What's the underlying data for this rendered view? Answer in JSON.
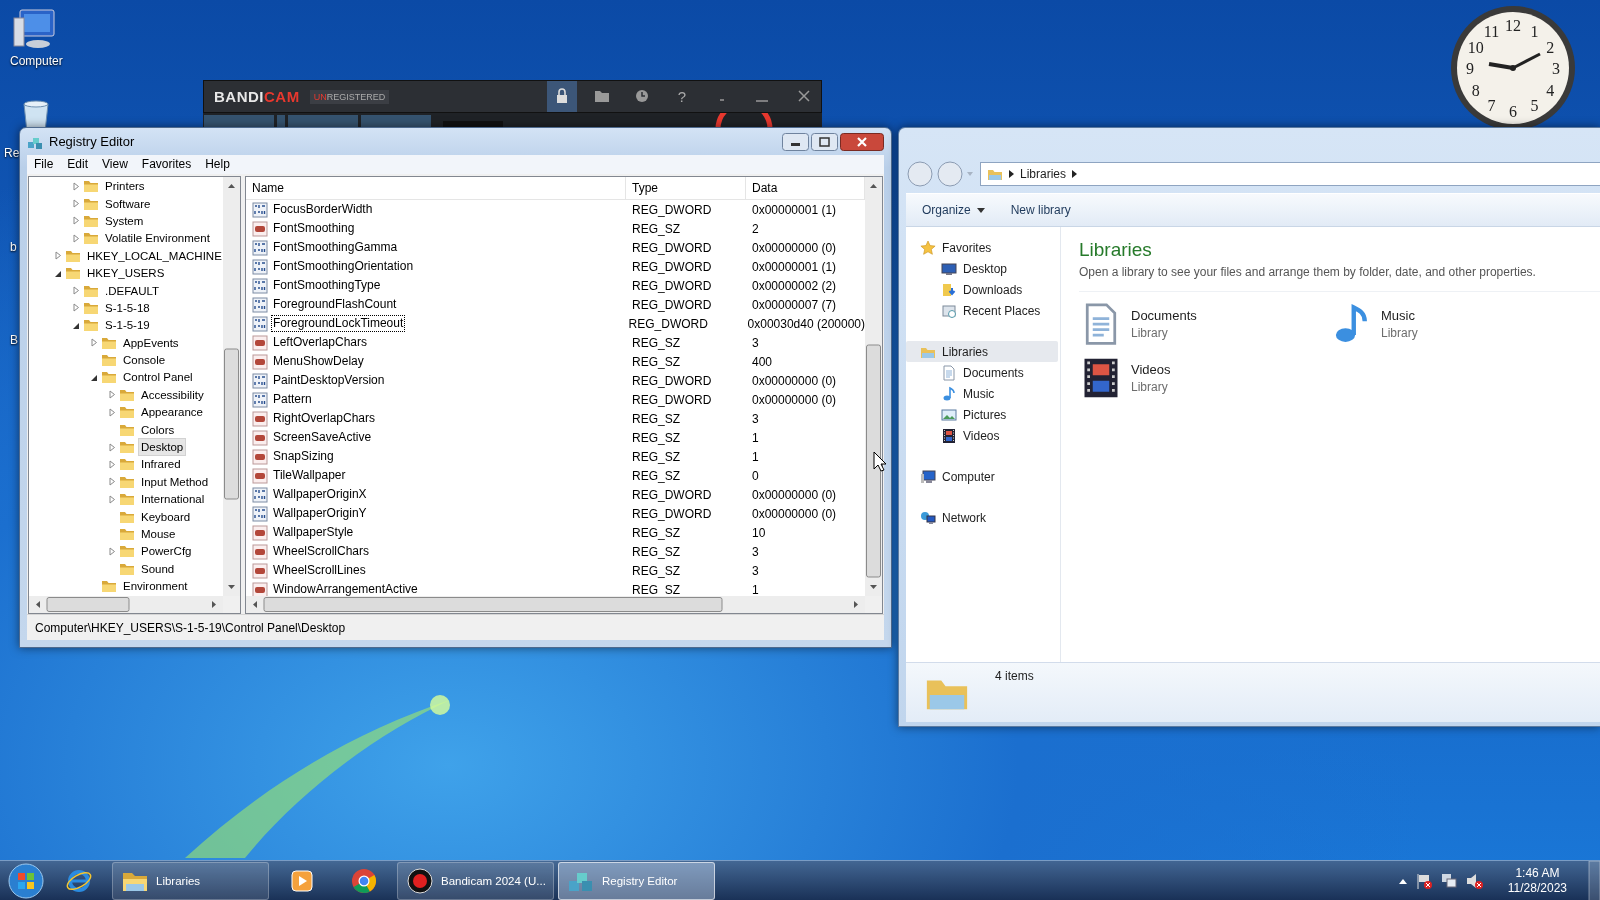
{
  "desktop_icons": [
    {
      "label": "Computer",
      "kind": "computer"
    },
    {
      "label": "Re",
      "kind": "recycle"
    },
    {
      "label": "b",
      "kind": "hidden"
    },
    {
      "label": "B",
      "kind": "hidden"
    }
  ],
  "bandicam": {
    "logo": [
      "BANDI",
      "CAM"
    ],
    "badge": [
      "UN",
      "REGISTERED"
    ],
    "help": "?"
  },
  "clock": {
    "numerals": [
      "11",
      "12",
      "1",
      "10",
      "2",
      "9",
      "3",
      "8",
      "4",
      "7",
      "5",
      "6"
    ]
  },
  "registry_editor": {
    "title": "Registry Editor",
    "menu": [
      "File",
      "Edit",
      "View",
      "Favorites",
      "Help"
    ],
    "tree": {
      "upper_items": [
        {
          "label": "Printers",
          "expanded": false,
          "selected": false
        },
        {
          "label": "Software",
          "expanded": false,
          "selected": false
        },
        {
          "label": "System",
          "expanded": false,
          "selected": false
        },
        {
          "label": "Volatile Environment",
          "expanded": false,
          "selected": false
        }
      ],
      "items": [
        {
          "label": "HKEY_LOCAL_MACHINE",
          "expanded": false,
          "selected": false
        },
        {
          "label": "HKEY_USERS",
          "expanded": true,
          "selected": false,
          "children": [
            {
              "label": ".DEFAULT",
              "expanded": false,
              "selected": false
            },
            {
              "label": "S-1-5-18",
              "expanded": false,
              "selected": false
            },
            {
              "label": "S-1-5-19",
              "expanded": true,
              "selected": false,
              "children": [
                {
                  "label": "AppEvents",
                  "expanded": false,
                  "selected": false
                },
                {
                  "label": "Console",
                  "selected": false
                },
                {
                  "label": "Control Panel",
                  "expanded": true,
                  "selected": false,
                  "children": [
                    {
                      "label": "Accessibility",
                      "expanded": false,
                      "selected": false
                    },
                    {
                      "label": "Appearance",
                      "expanded": false,
                      "selected": false
                    },
                    {
                      "label": "Colors",
                      "selected": false
                    },
                    {
                      "label": "Desktop",
                      "expanded": false,
                      "selected": true
                    },
                    {
                      "label": "Infrared",
                      "expanded": false,
                      "selected": false
                    },
                    {
                      "label": "Input Method",
                      "expanded": false,
                      "selected": false
                    },
                    {
                      "label": "International",
                      "expanded": false,
                      "selected": false
                    },
                    {
                      "label": "Keyboard",
                      "selected": false
                    },
                    {
                      "label": "Mouse",
                      "selected": false
                    },
                    {
                      "label": "PowerCfg",
                      "expanded": false,
                      "selected": false
                    },
                    {
                      "label": "Sound",
                      "selected": false
                    }
                  ]
                },
                {
                  "label": "Environment",
                  "selected": false
                }
              ]
            }
          ]
        }
      ]
    },
    "columns": [
      "Name",
      "Type",
      "Data"
    ],
    "rows": [
      {
        "name": "FocusBorderWidth",
        "type": "REG_DWORD",
        "data": "0x00000001 (1)",
        "kind": "dword",
        "focused": false
      },
      {
        "name": "FontSmoothing",
        "type": "REG_SZ",
        "data": "2",
        "kind": "sz",
        "focused": false
      },
      {
        "name": "FontSmoothingGamma",
        "type": "REG_DWORD",
        "data": "0x00000000 (0)",
        "kind": "dword",
        "focused": false
      },
      {
        "name": "FontSmoothingOrientation",
        "type": "REG_DWORD",
        "data": "0x00000001 (1)",
        "kind": "dword",
        "focused": false
      },
      {
        "name": "FontSmoothingType",
        "type": "REG_DWORD",
        "data": "0x00000002 (2)",
        "kind": "dword",
        "focused": false
      },
      {
        "name": "ForegroundFlashCount",
        "type": "REG_DWORD",
        "data": "0x00000007 (7)",
        "kind": "dword",
        "focused": false
      },
      {
        "name": "ForegroundLockTimeout",
        "type": "REG_DWORD",
        "data": "0x00030d40 (200000)",
        "kind": "dword",
        "focused": true
      },
      {
        "name": "LeftOverlapChars",
        "type": "REG_SZ",
        "data": "3",
        "kind": "sz",
        "focused": false
      },
      {
        "name": "MenuShowDelay",
        "type": "REG_SZ",
        "data": "400",
        "kind": "sz",
        "focused": false
      },
      {
        "name": "PaintDesktopVersion",
        "type": "REG_DWORD",
        "data": "0x00000000 (0)",
        "kind": "dword",
        "focused": false
      },
      {
        "name": "Pattern",
        "type": "REG_DWORD",
        "data": "0x00000000 (0)",
        "kind": "dword",
        "focused": false
      },
      {
        "name": "RightOverlapChars",
        "type": "REG_SZ",
        "data": "3",
        "kind": "sz",
        "focused": false
      },
      {
        "name": "ScreenSaveActive",
        "type": "REG_SZ",
        "data": "1",
        "kind": "sz",
        "focused": false
      },
      {
        "name": "SnapSizing",
        "type": "REG_SZ",
        "data": "1",
        "kind": "sz",
        "focused": false
      },
      {
        "name": "TileWallpaper",
        "type": "REG_SZ",
        "data": "0",
        "kind": "sz",
        "focused": false
      },
      {
        "name": "WallpaperOriginX",
        "type": "REG_DWORD",
        "data": "0x00000000 (0)",
        "kind": "dword",
        "focused": false
      },
      {
        "name": "WallpaperOriginY",
        "type": "REG_DWORD",
        "data": "0x00000000 (0)",
        "kind": "dword",
        "focused": false
      },
      {
        "name": "WallpaperStyle",
        "type": "REG_SZ",
        "data": "10",
        "kind": "sz",
        "focused": false
      },
      {
        "name": "WheelScrollChars",
        "type": "REG_SZ",
        "data": "3",
        "kind": "sz",
        "focused": false
      },
      {
        "name": "WheelScrollLines",
        "type": "REG_SZ",
        "data": "3",
        "kind": "sz",
        "focused": false
      },
      {
        "name": "WindowArrangementActive",
        "type": "REG_SZ",
        "data": "1",
        "kind": "sz",
        "focused": false
      }
    ],
    "status_bar": "Computer\\HKEY_USERS\\S-1-5-19\\Control Panel\\Desktop"
  },
  "explorer": {
    "address": [
      "Libraries"
    ],
    "toolbar": [
      {
        "label": "Organize",
        "dropdown": true
      },
      {
        "label": "New library",
        "dropdown": false
      }
    ],
    "nav": [
      {
        "label": "Favorites",
        "kind": "star",
        "selected": false,
        "children": [
          {
            "label": "Desktop",
            "kind": "desktop",
            "selected": false
          },
          {
            "label": "Downloads",
            "kind": "downloads",
            "selected": false
          },
          {
            "label": "Recent Places",
            "kind": "recent",
            "selected": false
          }
        ]
      },
      {
        "label": "Libraries",
        "kind": "library",
        "selected": true,
        "children": [
          {
            "label": "Documents",
            "kind": "documents",
            "selected": false
          },
          {
            "label": "Music",
            "kind": "music",
            "selected": false
          },
          {
            "label": "Pictures",
            "kind": "pictures",
            "selected": false
          },
          {
            "label": "Videos",
            "kind": "videos",
            "selected": false
          }
        ]
      },
      {
        "label": "Computer",
        "kind": "computer",
        "selected": false
      },
      {
        "label": "Network",
        "kind": "network",
        "selected": false
      }
    ],
    "heading": "Libraries",
    "description": "Open a library to see your files and arrange them by folder, date, and other properties.",
    "libraries": [
      {
        "name": "Documents",
        "subtitle": "Library",
        "kind": "documents"
      },
      {
        "name": "Music",
        "subtitle": "Library",
        "kind": "music"
      },
      {
        "name": "Videos",
        "subtitle": "Library",
        "kind": "videos"
      }
    ],
    "status": "4 items"
  },
  "taskbar": {
    "items": [
      {
        "kind": "ie",
        "selected": false
      },
      {
        "kind": "folder",
        "label": "Libraries",
        "selected": false
      },
      {
        "kind": "media",
        "selected": false
      },
      {
        "kind": "chrome",
        "selected": false
      },
      {
        "kind": "record",
        "label": "Bandicam 2024 (U...",
        "selected": false
      },
      {
        "kind": "registry",
        "label": "Registry Editor",
        "selected": true
      }
    ],
    "time": "1:46 AM",
    "date": "11/28/2023"
  }
}
